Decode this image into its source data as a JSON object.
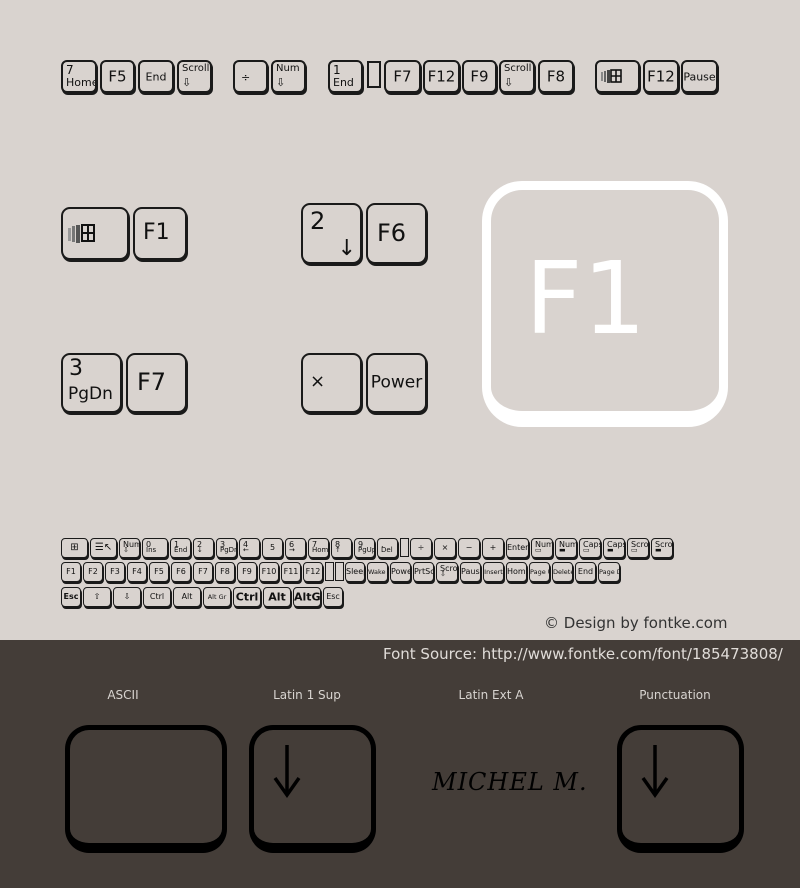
{
  "top_row": {
    "keys": [
      {
        "top": "7",
        "bottom": "Home"
      },
      {
        "label": "F5"
      },
      {
        "label": "End"
      },
      {
        "top": "Scroll",
        "bottom": "⇩"
      },
      {
        "label": "÷"
      },
      {
        "top": "Num",
        "bottom": "⇩"
      },
      {
        "top": "1",
        "bottom": "End"
      },
      {
        "label": "F7"
      },
      {
        "label": "F12"
      },
      {
        "label": "F9"
      },
      {
        "top": "Scroll",
        "bottom": "⇩"
      },
      {
        "label": "F8"
      },
      {
        "icon": "windows-logo-icon"
      },
      {
        "label": "F12"
      },
      {
        "label": "Pause"
      }
    ]
  },
  "medium_pairs": [
    {
      "keys": [
        {
          "icon": "windows-logo-icon"
        },
        {
          "label": "F1"
        }
      ]
    },
    {
      "keys": [
        {
          "top": "2",
          "corner": "↓"
        },
        {
          "label": "F6"
        }
      ]
    },
    {
      "keys": [
        {
          "top": "3",
          "bottom": "PgDn"
        },
        {
          "label": "F7"
        }
      ]
    },
    {
      "keys": [
        {
          "label": "×"
        },
        {
          "label": "Power"
        }
      ]
    }
  ],
  "big_key": {
    "label": "F1"
  },
  "charset_rows": {
    "row1": [
      "win",
      "menu",
      "Num ⇩",
      "0 Ins",
      "1 End",
      "2 ↓",
      "3 PgDn",
      "4 ←",
      "5",
      "6 →",
      "7 Home",
      "8 ↑",
      "9 PgUp",
      ". Del",
      "bar",
      "÷",
      "×",
      "−",
      "+",
      "Enter",
      "Num ▭",
      "Num ▬",
      "Caps ▭",
      "Caps ▬",
      "Scroll ▭",
      "Scroll ▬"
    ],
    "row2": [
      "F1",
      "F2",
      "F3",
      "F4",
      "F5",
      "F6",
      "F7",
      "F8",
      "F9",
      "F10",
      "F11",
      "F12",
      "bar",
      "bar",
      "Sleep",
      "Wake up",
      "Power",
      "PrtSc",
      "Scroll ⇩",
      "Pause",
      "Insert",
      "Home",
      "Page Up",
      "Delete",
      "End",
      "Page Down"
    ],
    "row3": [
      "Esc",
      "⇧",
      "⇩",
      "Ctrl",
      "Alt",
      "Alt Gr",
      "Ctrl",
      "Alt",
      "AltGr",
      "Esc"
    ]
  },
  "credit": "© Design by fontke.com",
  "font_source": "Font Source: http://www.fontke.com/font/185473808/",
  "categories": [
    {
      "name": "ASCII",
      "glyph": ""
    },
    {
      "name": "Latin 1 Sup",
      "glyph": "↓"
    },
    {
      "name": "Latin Ext A",
      "glyph": "MICHEL M."
    },
    {
      "name": "Punctuation",
      "glyph": "↓"
    }
  ]
}
